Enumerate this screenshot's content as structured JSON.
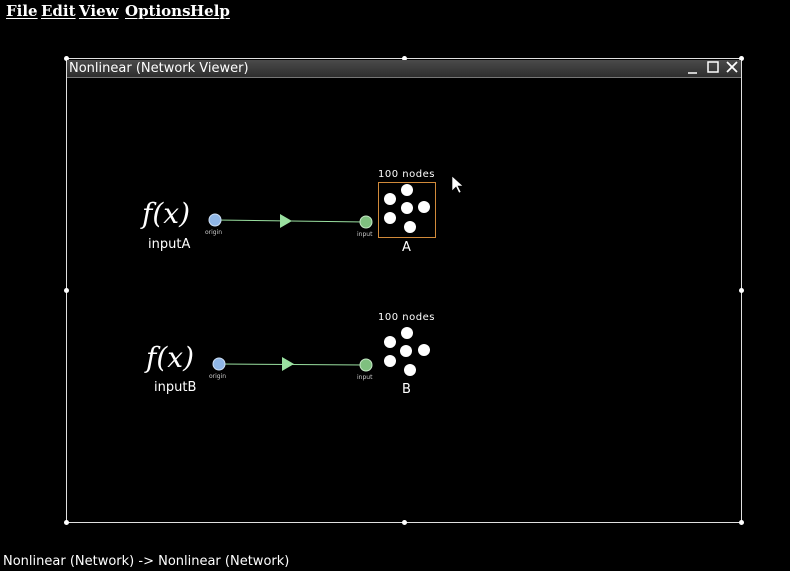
{
  "menu": {
    "file": "File",
    "edit": "Edit",
    "view": "View",
    "options": "Options",
    "help": "Help"
  },
  "window": {
    "title": "Nonlinear (Network Viewer)"
  },
  "network": {
    "inputs": [
      {
        "name": "inputA",
        "function": "f(x)",
        "port_label": "origin"
      },
      {
        "name": "inputB",
        "function": "f(x)",
        "port_label": "origin"
      }
    ],
    "ensembles": [
      {
        "name": "A",
        "count_label": "100 nodes",
        "input_label": "input",
        "selected": true
      },
      {
        "name": "B",
        "count_label": "100 nodes",
        "input_label": "input",
        "selected": false
      }
    ]
  },
  "status_bar": "Nonlinear (Network) -> Nonlinear (Network)",
  "colors": {
    "origin_port": "#8fb6e6",
    "input_port": "#7fc07f",
    "projection": "#9ae0a0",
    "selection": "#d18a3a"
  }
}
